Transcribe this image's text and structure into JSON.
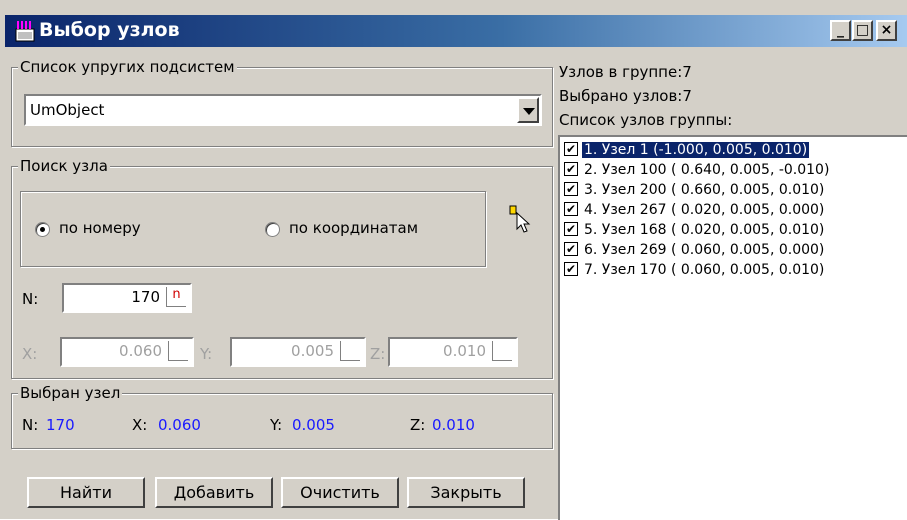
{
  "window": {
    "title": "Выбор узлов",
    "minimize": "_",
    "maximize": "□",
    "close": "×"
  },
  "subsystems": {
    "legend": "Список упругих подсистем",
    "selected": "UmObject"
  },
  "search": {
    "legend": "Поиск узла",
    "by_number": "по номеру",
    "by_coordinates": "по координатам",
    "mode": "by_number",
    "n_label": "N:",
    "n_value": "170",
    "n_marker": "n",
    "x_label": "X:",
    "x_value": "0.060",
    "y_label": "Y:",
    "y_value": "0.005",
    "z_label": "Z:",
    "z_value": "0.010"
  },
  "selected_node": {
    "legend": "Выбран узел",
    "n_label": "N:",
    "n_value": "170",
    "x_label": "X:",
    "x_value": "0.060",
    "y_label": "Y:",
    "y_value": "0.005",
    "z_label": "Z:",
    "z_value": "0.010"
  },
  "buttons": {
    "find": "Найти",
    "add": "Добавить",
    "clear": "Очистить",
    "close": "Закрыть"
  },
  "group_info": {
    "nodes_in_group": "Узлов в группе:7",
    "nodes_selected": "Выбрано узлов:7",
    "list_title": "Список узлов группы:"
  },
  "nodes": [
    {
      "text": "1. Узел 1 (-1.000,  0.005,  0.010)",
      "checked": true,
      "selected": true
    },
    {
      "text": "2. Узел 100 (  0.640,  0.005, -0.010)",
      "checked": true,
      "selected": false
    },
    {
      "text": "3. Узел 200 (  0.660,  0.005,  0.010)",
      "checked": true,
      "selected": false
    },
    {
      "text": "4. Узел 267 (  0.020,  0.005,  0.000)",
      "checked": true,
      "selected": false
    },
    {
      "text": "5. Узел 168 (  0.020,  0.005,  0.010)",
      "checked": true,
      "selected": false
    },
    {
      "text": "6. Узел 269 (  0.060,  0.005,  0.000)",
      "checked": true,
      "selected": false
    },
    {
      "text": "7. Узел 170 (  0.060,  0.005,  0.010)",
      "checked": true,
      "selected": false
    }
  ],
  "colors": {
    "title_start": "#0a246a",
    "title_end": "#a6caf0",
    "face": "#d4d0c8",
    "value_blue": "#1a1aff",
    "selection": "#0a246a"
  }
}
